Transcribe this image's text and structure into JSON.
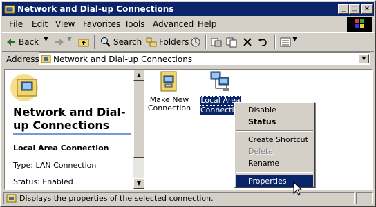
{
  "window": {
    "title": "Network and Dial-up Connections",
    "controls": {
      "minimize": "_",
      "maximize": "□",
      "close": "×"
    }
  },
  "menubar": [
    "File",
    "Edit",
    "View",
    "Favorites",
    "Tools",
    "Advanced",
    "Help"
  ],
  "toolbar": {
    "back": "Back",
    "search": "Search",
    "folders": "Folders"
  },
  "address": {
    "label": "Address",
    "value": "Network and Dial-up Connections"
  },
  "leftpane": {
    "title": "Network and Dial-up Connections",
    "selected_name": "Local Area Connection",
    "type": "Type: LAN Connection",
    "status": "Status: Enabled"
  },
  "items": [
    {
      "label_line1": "Make New",
      "label_line2": "Connection",
      "icon": "wizard-icon"
    },
    {
      "label_line1": "Local Area",
      "label_line2": "Connection",
      "icon": "network-connection-icon"
    }
  ],
  "context_menu": {
    "disable": "Disable",
    "status": "Status",
    "create_shortcut": "Create Shortcut",
    "delete": "Delete",
    "rename": "Rename",
    "properties": "Properties"
  },
  "statusbar": {
    "text": "Displays the properties of the selected connection."
  },
  "colors": {
    "titlebar": "#0a246a",
    "face": "#d4d0c8",
    "highlight": "#0a246a"
  }
}
